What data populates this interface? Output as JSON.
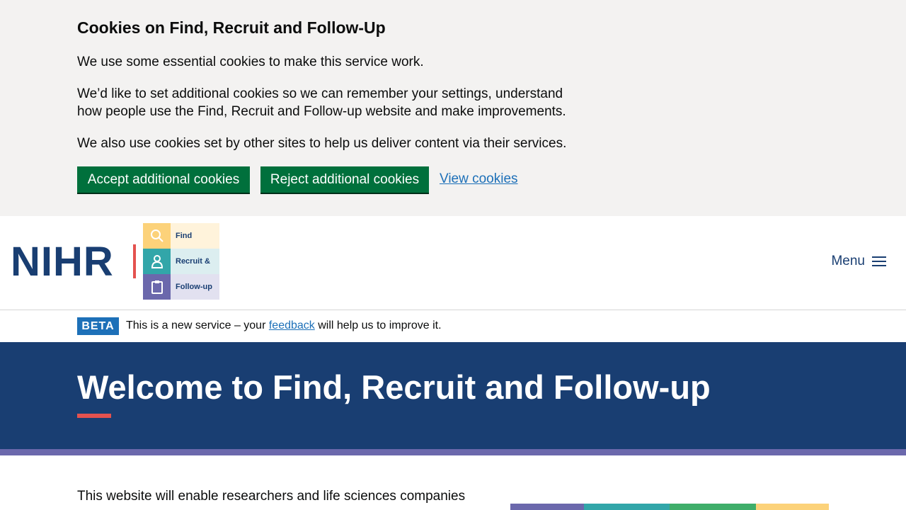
{
  "cookie_banner": {
    "title": "Cookies on Find, Recruit and Follow-Up",
    "p1": "We use some essential cookies to make this service work.",
    "p2": "We’d like to set additional cookies so we can remember your settings, understand how people use the Find, Recruit and Follow-up website and make improvements.",
    "p3": "We also use cookies set by other sites to help us deliver content via their services.",
    "accept_label": "Accept additional cookies",
    "reject_label": "Reject additional cookies",
    "view_label": "View cookies"
  },
  "header": {
    "logo_text": "NIHR",
    "tiles": [
      {
        "label": "Find",
        "icon": "search-icon"
      },
      {
        "label": "Recruit &",
        "icon": "person-icon"
      },
      {
        "label": "Follow-up",
        "icon": "clipboard-icon"
      }
    ],
    "menu_label": "Menu",
    "menu_icon": "hamburger-icon"
  },
  "beta": {
    "tag": "BETA",
    "text_before": "This is a new service – your ",
    "link": "feedback",
    "text_after": " will help us to improve it."
  },
  "hero": {
    "title": "Welcome to Find, Recruit and Follow-up"
  },
  "main": {
    "intro": "This website will enable researchers and life sciences companies"
  },
  "colors": {
    "navy": "#193e72",
    "green_button": "#00703c",
    "link_blue": "#1d70b8",
    "accent_red": "#e4524f",
    "purple": "#6b68ac",
    "teal": "#32a6a9",
    "yellow": "#fcd27a",
    "banner_bg": "#f3f2f1"
  }
}
